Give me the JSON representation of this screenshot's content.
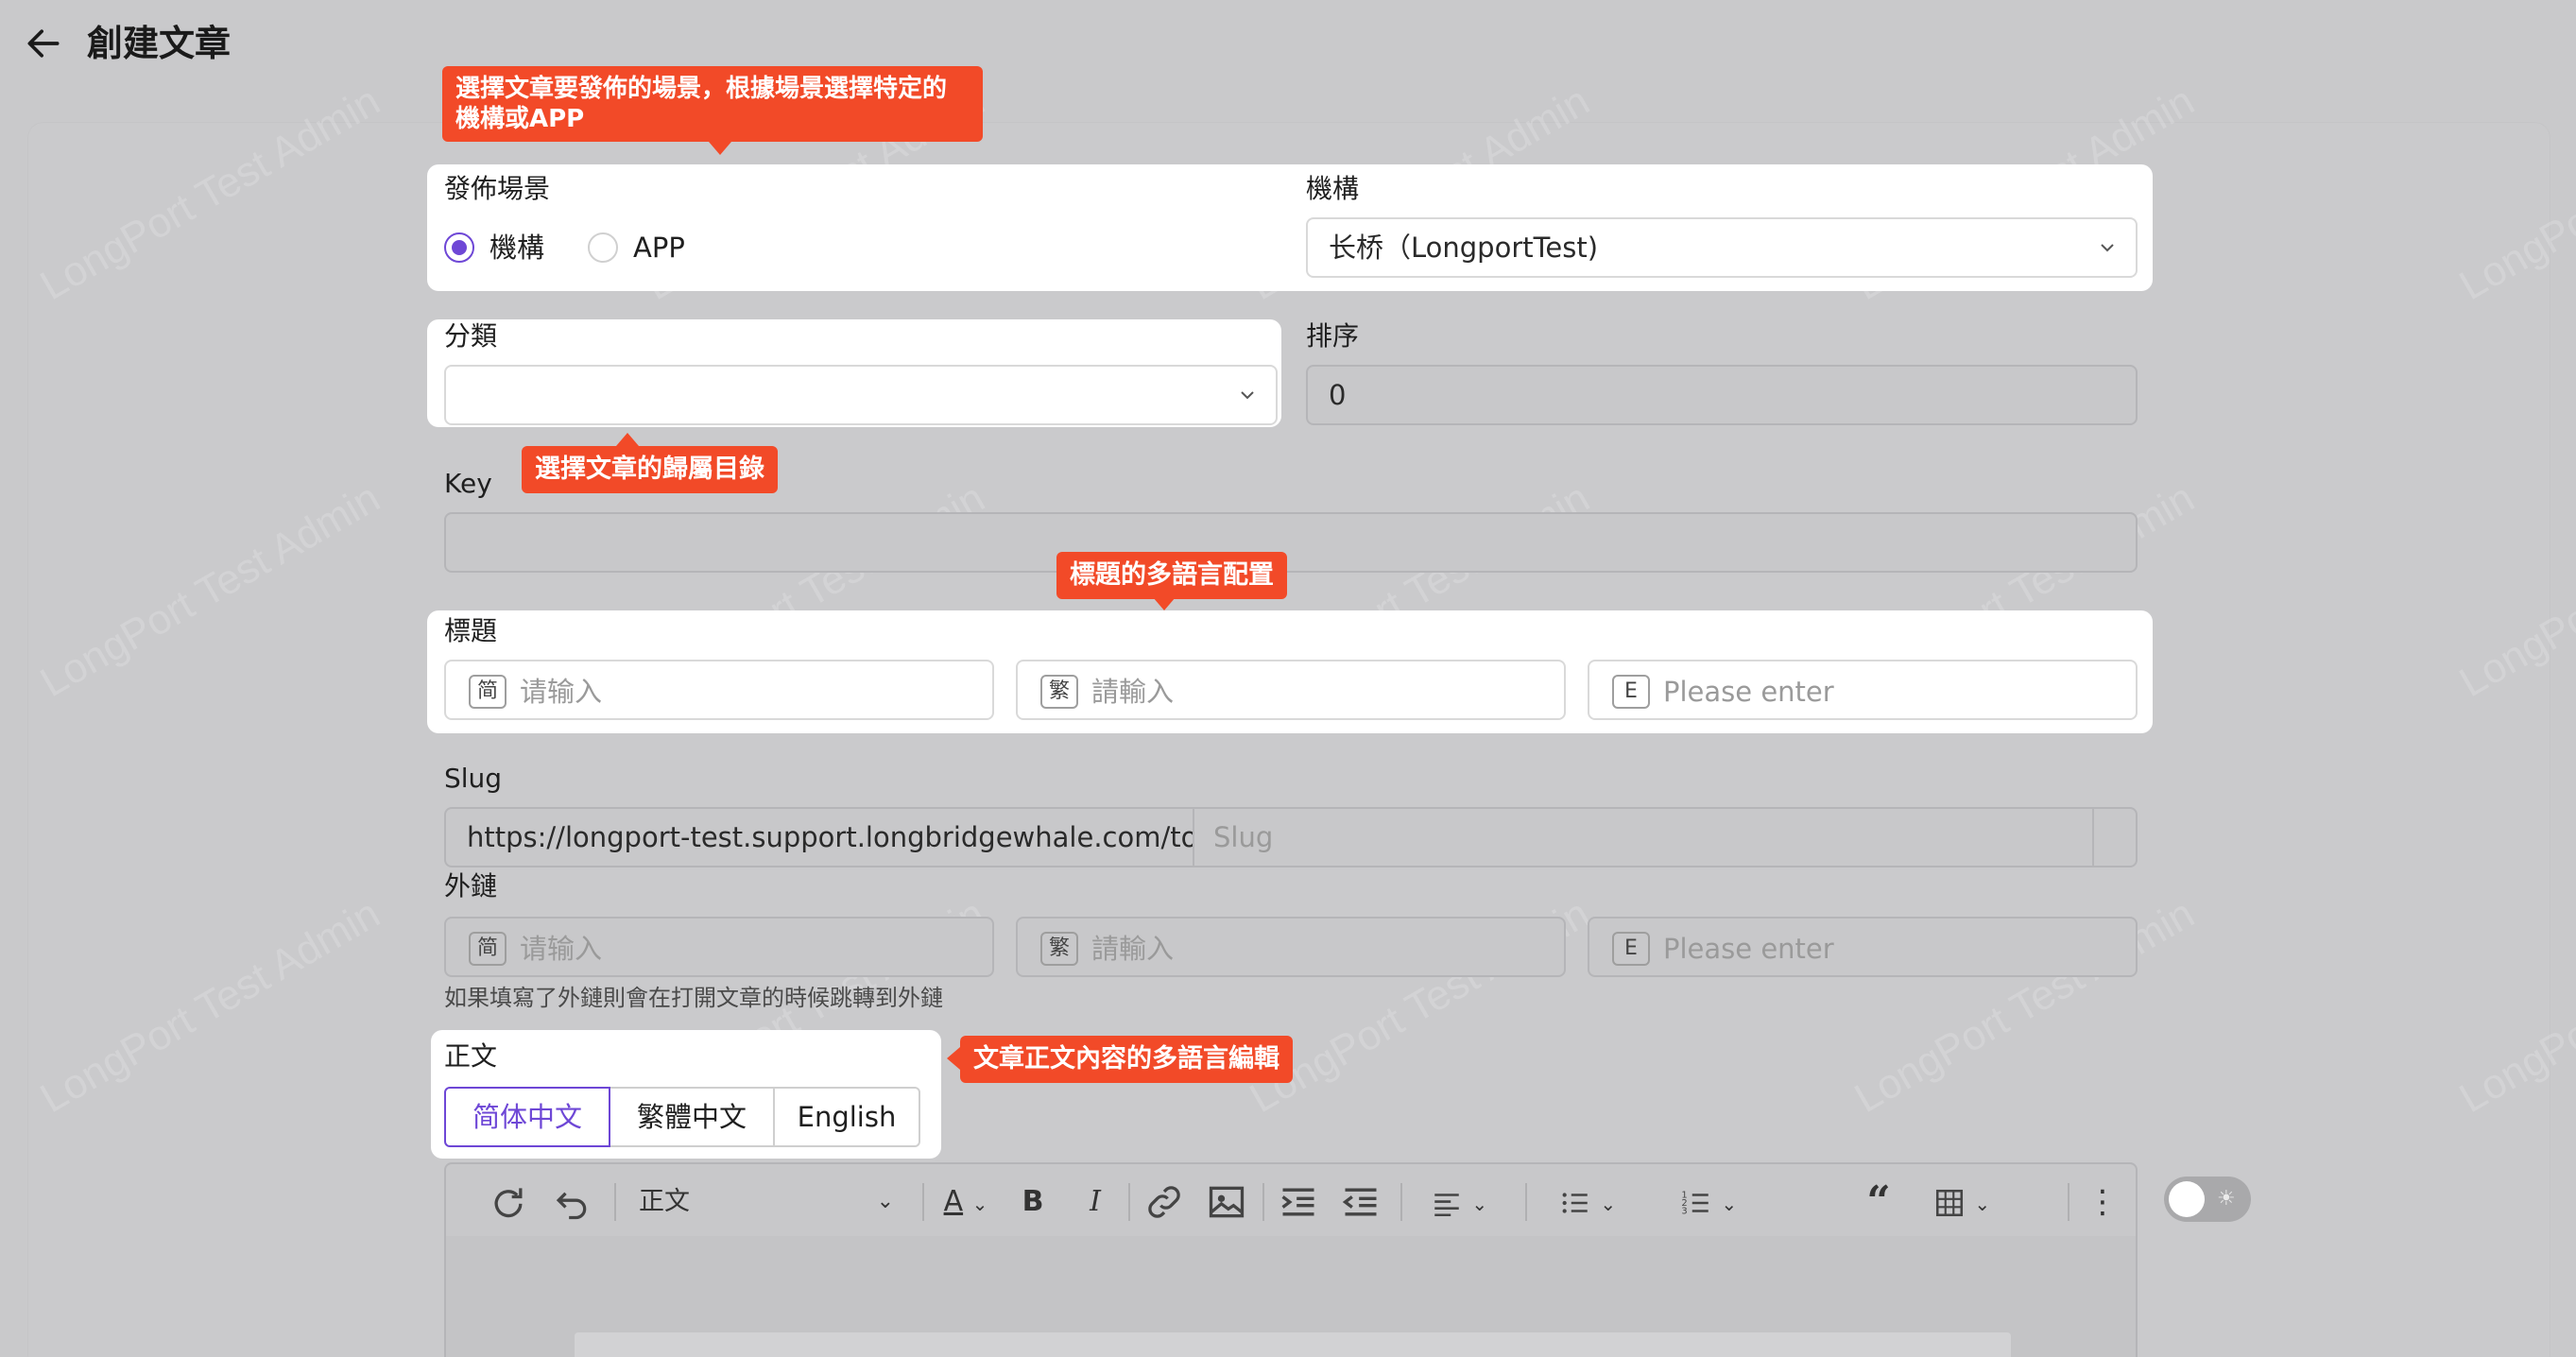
{
  "page": {
    "title": "創建文章"
  },
  "tooltips": {
    "scene": "選擇文章要發佈的場景，根據場景選擇特定的機構或APP",
    "category": "選擇文章的歸屬目錄",
    "title_i18n": "標題的多語言配置",
    "content_i18n": "文章正文內容的多語言編輯"
  },
  "form": {
    "scene": {
      "label": "發佈場景",
      "options": [
        "機構",
        "APP"
      ],
      "selected": "機構"
    },
    "org": {
      "label": "機構",
      "value": "长桥（LongportTest)"
    },
    "category": {
      "label": "分類",
      "value": ""
    },
    "order": {
      "label": "排序",
      "value": "0"
    },
    "key": {
      "label": "Key",
      "value": ""
    },
    "title": {
      "label": "標題",
      "fields": [
        {
          "tag": "简",
          "placeholder": "请输入"
        },
        {
          "tag": "繁",
          "placeholder": "請輸入"
        },
        {
          "tag": "E",
          "placeholder": "Please enter"
        }
      ]
    },
    "slug": {
      "label": "Slug",
      "prefix": "https://longport-test.support.longbridgewhale.com/topics",
      "placeholder": "Slug"
    },
    "external_link": {
      "label": "外鏈",
      "fields": [
        {
          "tag": "简",
          "placeholder": "请输入"
        },
        {
          "tag": "繁",
          "placeholder": "請輸入"
        },
        {
          "tag": "E",
          "placeholder": "Please enter"
        }
      ],
      "help": "如果填寫了外鏈則會在打開文章的時候跳轉到外鏈"
    },
    "content": {
      "label": "正文",
      "tabs": [
        "简体中文",
        "繁體中文",
        "English"
      ],
      "active_tab": "简体中文"
    }
  },
  "toolbar": {
    "block_type": "正文",
    "icons": [
      "redo-icon",
      "undo-icon",
      "text-color-icon",
      "bold-icon",
      "italic-icon",
      "link-icon",
      "image-icon",
      "indent-icon",
      "outdent-icon",
      "align-icon",
      "bullet-list-icon",
      "ordered-list-icon",
      "quote-icon",
      "table-icon",
      "more-icon"
    ]
  },
  "watermark": "LongPort Test Admin",
  "colors": {
    "accent": "#6e47d6",
    "tooltip": "#f24a28"
  }
}
